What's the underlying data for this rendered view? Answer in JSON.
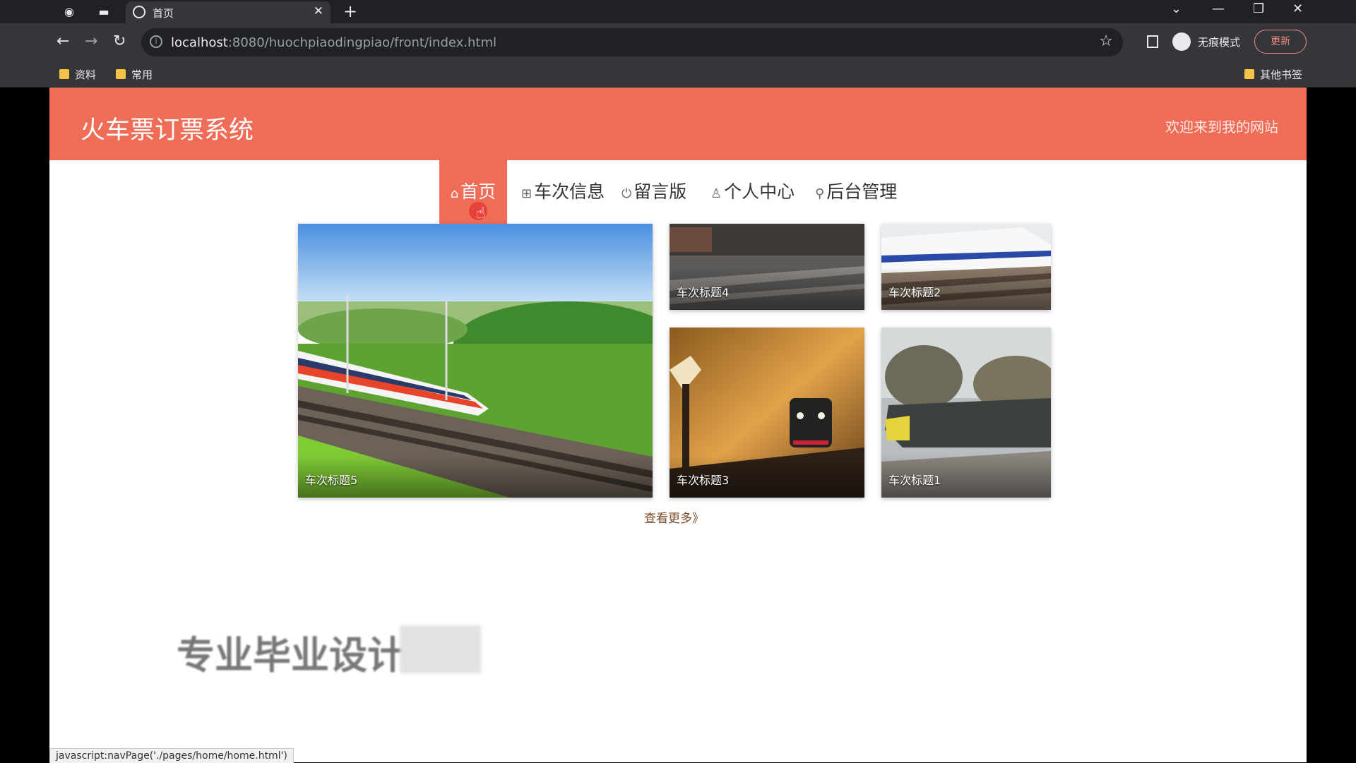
{
  "browser": {
    "tab_title": "首页",
    "url_host": "localhost",
    "url_rest": ":8080/huochpiaodingpiao/front/index.html",
    "incognito_label": "无痕模式",
    "update_label": "更新",
    "bookmarks": [
      "资料",
      "常用"
    ],
    "other_bookmarks": "其他书签",
    "status_url": "javascript:navPage('./pages/home/home.html')"
  },
  "site": {
    "title": "火车票订票系统",
    "welcome": "欢迎来到我的网站",
    "nav": [
      {
        "label": "首页",
        "icon": "home-icon",
        "active": true
      },
      {
        "label": "车次信息",
        "icon": "grid-icon",
        "active": false
      },
      {
        "label": "留言版",
        "icon": "power-icon",
        "active": false
      },
      {
        "label": "个人中心",
        "icon": "user-icon",
        "active": false
      },
      {
        "label": "后台管理",
        "icon": "link-icon",
        "active": false
      }
    ],
    "cards": [
      {
        "caption": "车次标题5"
      },
      {
        "caption": "车次标题4"
      },
      {
        "caption": "车次标题2"
      },
      {
        "caption": "车次标题3"
      },
      {
        "caption": "车次标题1"
      }
    ],
    "more_label": "查看更多》",
    "footer_title": "专业毕业设计"
  }
}
